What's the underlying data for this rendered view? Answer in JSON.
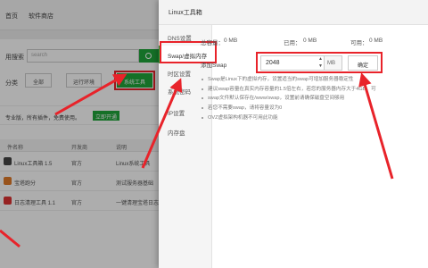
{
  "background": {
    "breadcrumb": [
      "首页",
      "软件商店"
    ],
    "search_label": "用搜索",
    "search_placeholder": "search",
    "category_label": "分类",
    "categories": [
      "全部",
      "运行环境",
      "系统工具"
    ],
    "promo_text": "专业版，所有插件，免费使用。",
    "promo_button": "立即开通",
    "table_headers": [
      "件名称",
      "开发商",
      "说明"
    ],
    "rows": [
      {
        "name": "Linux工具箱 1.5",
        "vendor": "官方",
        "desc": "Linux系统工具"
      },
      {
        "name": "宝塔跑分",
        "vendor": "官方",
        "desc": "测试服务器基础"
      },
      {
        "name": "日志清理工具 1.1",
        "vendor": "官方",
        "desc": "一键清理宝塔日志"
      }
    ]
  },
  "modal": {
    "title": "Linux工具箱",
    "sidebar": [
      "DNS设置",
      "Swap/虚拟内存",
      "时区设置",
      "系统密码",
      "IP设置",
      "内存盘"
    ],
    "stats": {
      "total_label": "总容量：",
      "total_value": "0 MB",
      "used_label": "已用：",
      "used_value": "0 MB",
      "free_label": "可用：",
      "free_value": "0 MB"
    },
    "swap_label": "添加Swap",
    "swap_value": "2048",
    "unit": "MB",
    "confirm_button": "确定",
    "spin_up": "▲",
    "spin_down": "▼",
    "tips": [
      "Swap是Linux下的虚拟内存，设置适当的swap可增加服务器稳定性",
      "建议swap容量在真实内存容量的1.5倍左右，若您的服务器内存大于4GB，可",
      "swap文件默认保存在/www/swap，设置前请确保磁盘空间够用",
      "若您不需要swap，请将容量设为0",
      "OVZ虚拟架构机器不可用此功能"
    ]
  },
  "colors": {
    "accent_green": "#20a53a",
    "highlight_red": "#e8232a"
  }
}
